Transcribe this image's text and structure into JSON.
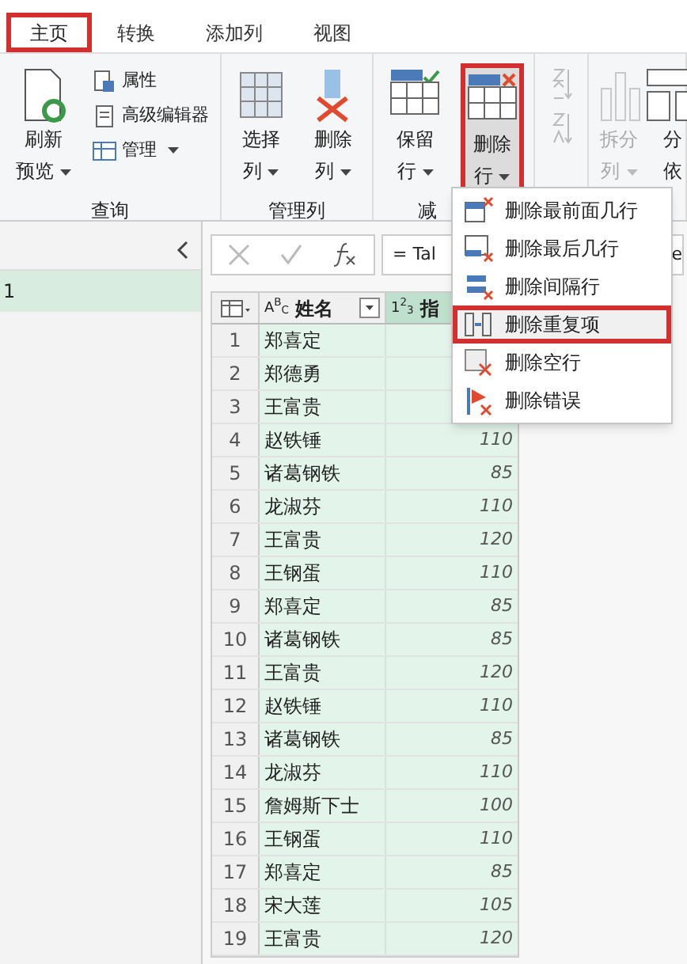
{
  "tabs": [
    {
      "label": "主页",
      "selected": true
    },
    {
      "label": "转换",
      "selected": false
    },
    {
      "label": "添加列",
      "selected": false
    },
    {
      "label": "视图",
      "selected": false
    }
  ],
  "ribbon": {
    "groups": [
      {
        "label": "查询",
        "items": [
          {
            "kind": "large",
            "lines": [
              "刷新",
              "预览"
            ],
            "dropdown": true,
            "highlighted": false,
            "disabled": false
          },
          {
            "kind": "small",
            "label": "属性",
            "dropdown": false
          },
          {
            "kind": "small",
            "label": "高级编辑器",
            "dropdown": false
          },
          {
            "kind": "small",
            "label": "管理",
            "dropdown": true
          }
        ]
      },
      {
        "label": "管理列",
        "items": [
          {
            "kind": "large",
            "lines": [
              "选择",
              "列"
            ],
            "dropdown": true,
            "highlighted": false,
            "disabled": false
          },
          {
            "kind": "large",
            "lines": [
              "删除",
              "列"
            ],
            "dropdown": true,
            "highlighted": false,
            "disabled": false
          }
        ]
      },
      {
        "label": "减",
        "items": [
          {
            "kind": "large",
            "lines": [
              "保留",
              "行"
            ],
            "dropdown": true,
            "highlighted": false,
            "disabled": false
          },
          {
            "kind": "large",
            "lines": [
              "删除",
              "行"
            ],
            "dropdown": true,
            "highlighted": true,
            "disabled": false
          }
        ]
      },
      {
        "items": [
          {
            "kind": "sort"
          }
        ]
      },
      {
        "items": [
          {
            "kind": "large",
            "lines": [
              "拆分",
              "列"
            ],
            "dropdown": true,
            "highlighted": false,
            "disabled": true
          },
          {
            "kind": "large",
            "lines": [
              "分",
              "依"
            ],
            "dropdown": false,
            "highlighted": false,
            "disabled": false
          }
        ]
      }
    ]
  },
  "queries": {
    "items": [
      {
        "label": "1",
        "selected": true
      }
    ]
  },
  "formula_bar": {
    "value": "= Tal",
    "tail": "e"
  },
  "table": {
    "columns": [
      {
        "type": "A$^{B}$$_{C}$",
        "label": "姓名"
      },
      {
        "type": "1$^{2}$$_{3}$",
        "label": "指"
      }
    ],
    "rows": [
      {
        "index": "1",
        "name": "郑喜定"
      },
      {
        "index": "2",
        "name": "郑德勇"
      },
      {
        "index": "3",
        "name": "王富贵"
      },
      {
        "index": "4",
        "name": "赵铁锤",
        "value": "110"
      },
      {
        "index": "5",
        "name": "诸葛钢铁",
        "value": "85"
      },
      {
        "index": "6",
        "name": "龙淑芬",
        "value": "110"
      },
      {
        "index": "7",
        "name": "王富贵",
        "value": "120"
      },
      {
        "index": "8",
        "name": "王钢蛋",
        "value": "110"
      },
      {
        "index": "9",
        "name": "郑喜定",
        "value": "85"
      },
      {
        "index": "10",
        "name": "诸葛钢铁",
        "value": "85"
      },
      {
        "index": "11",
        "name": "王富贵",
        "value": "120"
      },
      {
        "index": "12",
        "name": "赵铁锤",
        "value": "110"
      },
      {
        "index": "13",
        "name": "诸葛钢铁",
        "value": "85"
      },
      {
        "index": "14",
        "name": "龙淑芬",
        "value": "110"
      },
      {
        "index": "15",
        "name": "詹姆斯下士",
        "value": "100"
      },
      {
        "index": "16",
        "name": "王钢蛋",
        "value": "110"
      },
      {
        "index": "17",
        "name": "郑喜定",
        "value": "85"
      },
      {
        "index": "18",
        "name": "宋大莲",
        "value": "105"
      },
      {
        "index": "19",
        "name": "王富贵",
        "value": "120"
      }
    ]
  },
  "menu": {
    "items": [
      {
        "label": "删除最前面几行",
        "selected": false
      },
      {
        "label": "删除最后几行",
        "selected": false
      },
      {
        "label": "删除间隔行",
        "selected": false
      },
      {
        "label": "删除重复项",
        "selected": true
      },
      {
        "label": "删除空行",
        "selected": false
      },
      {
        "label": "删除错误",
        "selected": false
      }
    ]
  }
}
